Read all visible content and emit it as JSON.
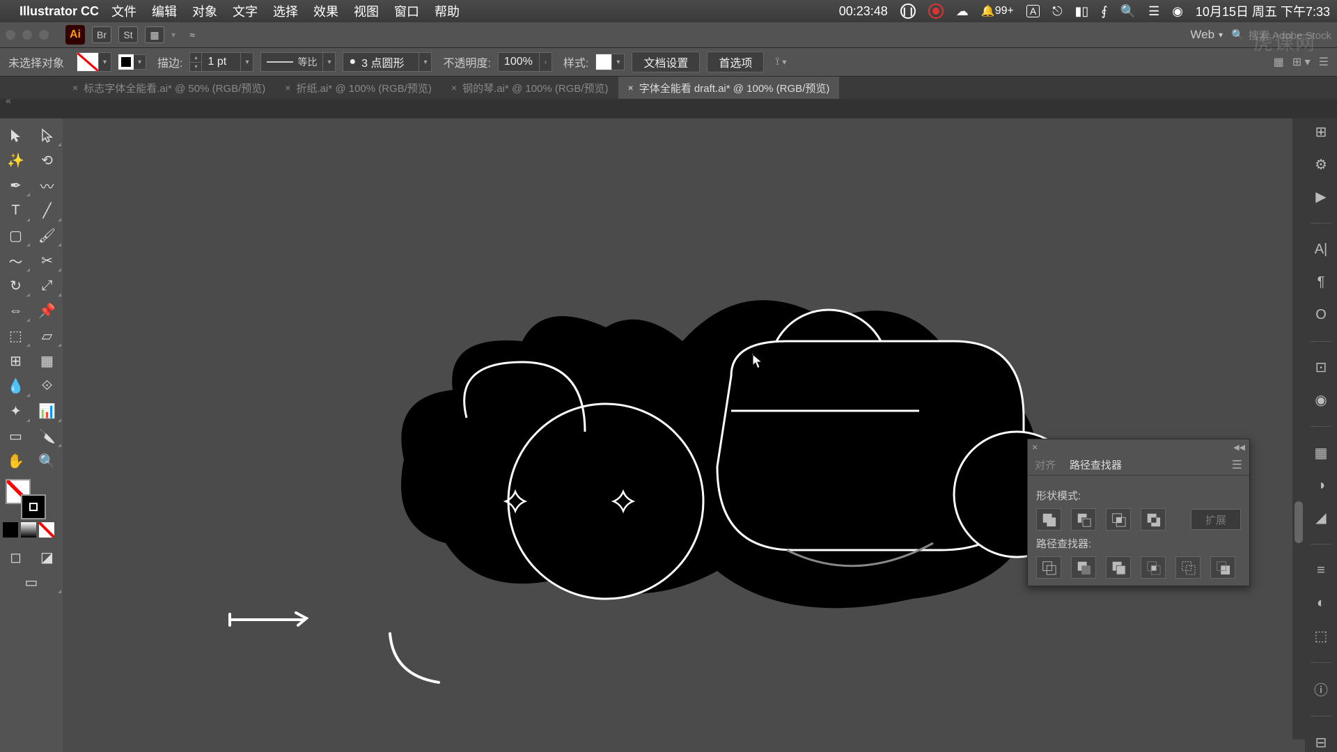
{
  "menubar": {
    "app_name": "Illustrator CC",
    "items": [
      "文件",
      "编辑",
      "对象",
      "文字",
      "选择",
      "效果",
      "视图",
      "窗口",
      "帮助"
    ],
    "timer": "00:23:48",
    "notif": "99+",
    "date": "10月15日 周五 下午7:33"
  },
  "apptoolbar": {
    "doc_profile": "Web",
    "search_placeholder": "搜索 Adobe Stock"
  },
  "controlbar": {
    "selection": "未选择对象",
    "stroke_label": "描边:",
    "stroke_val": "1 pt",
    "stroke_profile": "等比",
    "brush_profile": "3 点圆形",
    "opacity_label": "不透明度:",
    "opacity_val": "100%",
    "style_label": "样式:",
    "doc_setup": "文档设置",
    "preferences": "首选项"
  },
  "tabs": [
    {
      "label": "标志字体全能看.ai* @ 50% (RGB/预览)",
      "active": false
    },
    {
      "label": "折纸.ai* @ 100% (RGB/预览)",
      "active": false
    },
    {
      "label": "钢的琴.ai* @ 100% (RGB/预览)",
      "active": false
    },
    {
      "label": "字体全能看 draft.ai* @ 100% (RGB/预览)",
      "active": true
    }
  ],
  "pathfinder": {
    "tab_align": "对齐",
    "tab_pf": "路径查找器",
    "shape_modes": "形状模式:",
    "pf_label": "路径查找器:",
    "expand": "扩展"
  },
  "watermark": "虎课网"
}
